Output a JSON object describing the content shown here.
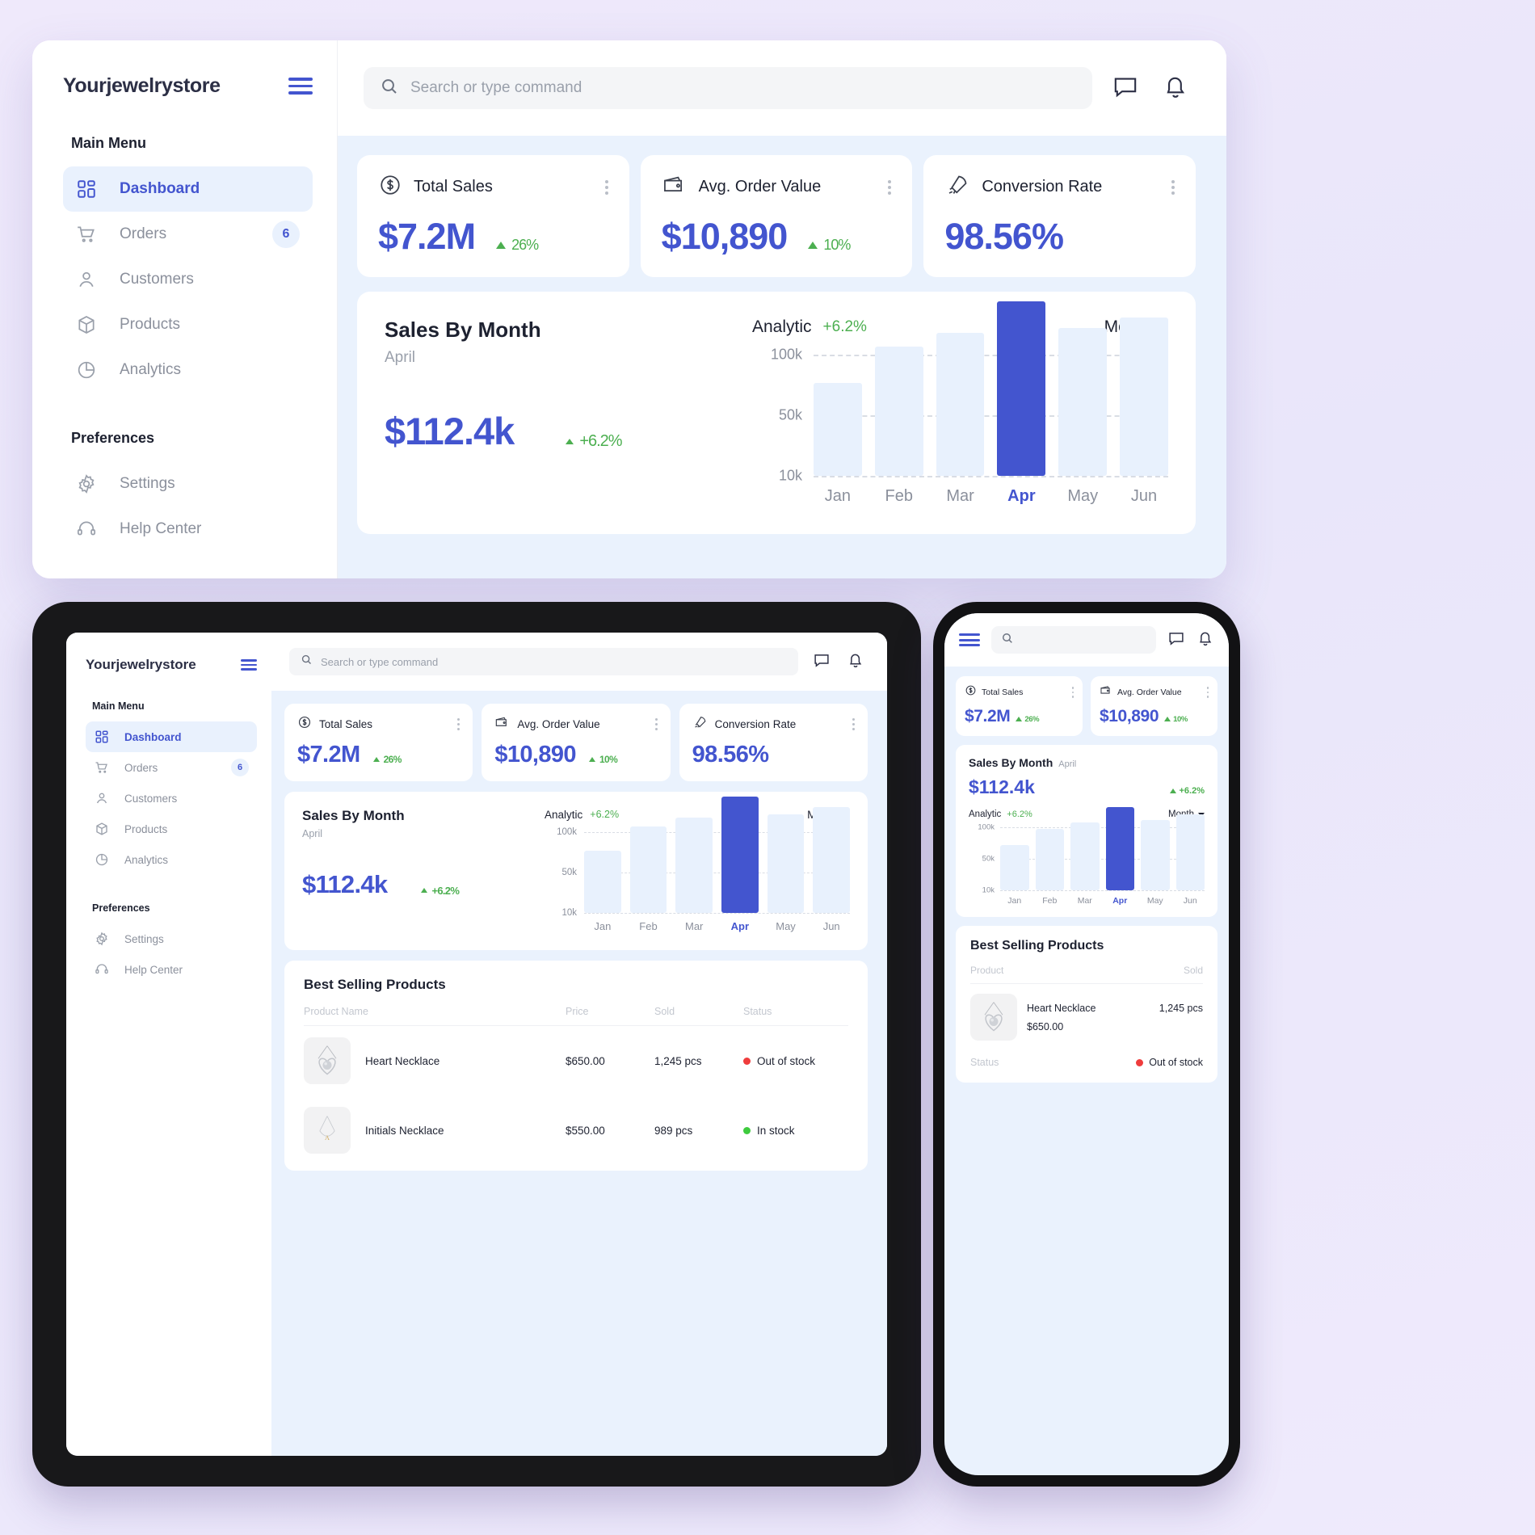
{
  "brand": {
    "name": "Yourjewelrystore"
  },
  "search": {
    "placeholder": "Search or type command"
  },
  "sidebar": {
    "main_title": "Main Menu",
    "prefs_title": "Preferences",
    "items": [
      {
        "label": "Dashboard",
        "icon": "dashboard-grid-icon",
        "badge": ""
      },
      {
        "label": "Orders",
        "icon": "shopping-cart-icon",
        "badge": "6"
      },
      {
        "label": "Customers",
        "icon": "user-icon",
        "badge": ""
      },
      {
        "label": "Products",
        "icon": "box-icon",
        "badge": ""
      },
      {
        "label": "Analytics",
        "icon": "pie-chart-icon",
        "badge": ""
      }
    ],
    "prefs": [
      {
        "label": "Settings",
        "icon": "gear-icon"
      },
      {
        "label": "Help Center",
        "icon": "headset-icon"
      }
    ]
  },
  "kpis": [
    {
      "title": "Total Sales",
      "icon": "dollar-circle-icon",
      "value": "$7.2M",
      "delta": "26%"
    },
    {
      "title": "Avg. Order Value",
      "icon": "wallet-icon",
      "value": "$10,890",
      "delta": "10%"
    },
    {
      "title": "Conversion Rate",
      "icon": "rocket-icon",
      "value": "98.56%",
      "delta": ""
    }
  ],
  "sales_card": {
    "title": "Sales By Month",
    "subtitle": "April",
    "value": "$112.4k",
    "delta": "+6.2%",
    "analytic_label": "Analytic",
    "analytic_delta": "+6.2%",
    "range_label": "Month"
  },
  "chart_data": {
    "type": "bar",
    "title": "Sales By Month",
    "categories": [
      "Jan",
      "Feb",
      "Mar",
      "Apr",
      "May",
      "Jun"
    ],
    "values": [
      52,
      78,
      88,
      112,
      92,
      100
    ],
    "highlight_index": 3,
    "ytick_labels": [
      "100k",
      "50k",
      "10k"
    ],
    "ytick_values": [
      100,
      50,
      10
    ],
    "ylim": [
      0,
      120
    ],
    "xlabel": "",
    "ylabel": "",
    "grid": true,
    "legend": "none",
    "bar_color": "#e8f1fd",
    "highlight_color": "#4355cf"
  },
  "products_table": {
    "title": "Best Selling Products",
    "columns": [
      "Product Name",
      "Price",
      "Sold",
      "Status"
    ],
    "mobile_columns": [
      "Product",
      "Sold"
    ],
    "mobile_status_label": "Status",
    "rows": [
      {
        "name": "Heart Necklace",
        "price": "$650.00",
        "sold": "1,245 pcs",
        "status": "Out of stock",
        "status_color": "#ef3c3c"
      },
      {
        "name": "Initials Necklace",
        "price": "$550.00",
        "sold": "989 pcs",
        "status": "In stock",
        "status_color": "#3ecb3e"
      }
    ]
  },
  "topbar_icons": [
    {
      "name": "chat-icon"
    },
    {
      "name": "bell-icon"
    }
  ],
  "colors": {
    "accent": "#4355cf",
    "success": "#4caf50",
    "danger": "#ef3c3c",
    "panel": "#eaf2fd",
    "page_bg": "#efe9fb"
  }
}
